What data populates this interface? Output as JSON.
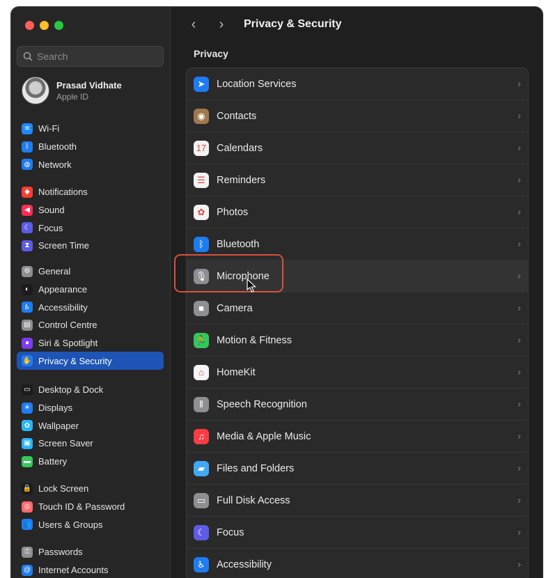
{
  "window": {
    "title": "Privacy & Security"
  },
  "search": {
    "placeholder": "Search"
  },
  "profile": {
    "name": "Prasad Vidhate",
    "subtitle": "Apple ID"
  },
  "sidebar": {
    "groups": [
      [
        {
          "label": "Wi-Fi",
          "icon": "wifi-icon",
          "color": "#1e88ff",
          "glyph": "≋"
        },
        {
          "label": "Bluetooth",
          "icon": "bluetooth-icon",
          "color": "#1e7cf2",
          "glyph": "ᛒ"
        },
        {
          "label": "Network",
          "icon": "globe-icon",
          "color": "#1e7cf2",
          "glyph": "◍"
        }
      ],
      [
        {
          "label": "Notifications",
          "icon": "bell-icon",
          "color": "#ff3b30",
          "glyph": "◆"
        },
        {
          "label": "Sound",
          "icon": "speaker-icon",
          "color": "#ff2d55",
          "glyph": "◀"
        },
        {
          "label": "Focus",
          "icon": "moon-icon",
          "color": "#5e5ce6",
          "glyph": "☾"
        },
        {
          "label": "Screen Time",
          "icon": "hourglass-icon",
          "color": "#5e5ce6",
          "glyph": "⧗"
        }
      ],
      [
        {
          "label": "General",
          "icon": "gear-icon",
          "color": "#8e8e93",
          "glyph": "⚙"
        },
        {
          "label": "Appearance",
          "icon": "appearance-icon",
          "color": "#1c1c1e",
          "glyph": "◐"
        },
        {
          "label": "Accessibility",
          "icon": "accessibility-icon",
          "color": "#1e7cf2",
          "glyph": "♿"
        },
        {
          "label": "Control Centre",
          "icon": "control-centre-icon",
          "color": "#8e8e93",
          "glyph": "▤"
        },
        {
          "label": "Siri & Spotlight",
          "icon": "siri-icon",
          "color": "#7d3cf0",
          "glyph": "●"
        },
        {
          "label": "Privacy & Security",
          "icon": "hand-icon",
          "color": "#1e7cf2",
          "glyph": "✋"
        }
      ],
      [
        {
          "label": "Desktop & Dock",
          "icon": "dock-icon",
          "color": "#1c1c1e",
          "glyph": "▭"
        },
        {
          "label": "Displays",
          "icon": "sun-icon",
          "color": "#1e7cf2",
          "glyph": "☀"
        },
        {
          "label": "Wallpaper",
          "icon": "flower-icon",
          "color": "#29b6f6",
          "glyph": "✿"
        },
        {
          "label": "Screen Saver",
          "icon": "screensaver-icon",
          "color": "#29b6f6",
          "glyph": "▣"
        },
        {
          "label": "Battery",
          "icon": "battery-icon",
          "color": "#34c759",
          "glyph": "▬"
        }
      ],
      [
        {
          "label": "Lock Screen",
          "icon": "lock-icon",
          "color": "#1c1c1e",
          "glyph": "🔒"
        },
        {
          "label": "Touch ID & Password",
          "icon": "fingerprint-icon",
          "color": "#ff6b6b",
          "glyph": "◎"
        },
        {
          "label": "Users & Groups",
          "icon": "users-icon",
          "color": "#1e7cf2",
          "glyph": "👥"
        }
      ],
      [
        {
          "label": "Passwords",
          "icon": "key-icon",
          "color": "#8e8e93",
          "glyph": "⚿"
        },
        {
          "label": "Internet Accounts",
          "icon": "at-icon",
          "color": "#1e7cf2",
          "glyph": "@"
        }
      ]
    ]
  },
  "main": {
    "section_title": "Privacy",
    "rows": [
      {
        "label": "Location Services",
        "icon": "location-arrow-icon",
        "color": "#1e7cf2",
        "glyph": "➤"
      },
      {
        "label": "Contacts",
        "icon": "contacts-icon",
        "color": "#a0784e",
        "glyph": "◉"
      },
      {
        "label": "Calendars",
        "icon": "calendar-icon",
        "color": "#f2f2f2",
        "glyph": "17"
      },
      {
        "label": "Reminders",
        "icon": "reminders-icon",
        "color": "#f2f2f2",
        "glyph": "☰"
      },
      {
        "label": "Photos",
        "icon": "photos-icon",
        "color": "#f2f2f2",
        "glyph": "✿"
      },
      {
        "label": "Bluetooth",
        "icon": "bluetooth-icon",
        "color": "#1e7cf2",
        "glyph": "ᛒ"
      },
      {
        "label": "Microphone",
        "icon": "microphone-icon",
        "color": "#8e8e93",
        "glyph": "🎙"
      },
      {
        "label": "Camera",
        "icon": "camera-icon",
        "color": "#8e8e93",
        "glyph": "■"
      },
      {
        "label": "Motion & Fitness",
        "icon": "fitness-icon",
        "color": "#34c759",
        "glyph": "🏃"
      },
      {
        "label": "HomeKit",
        "icon": "home-icon",
        "color": "#f5f5f5",
        "glyph": "⌂"
      },
      {
        "label": "Speech Recognition",
        "icon": "waveform-icon",
        "color": "#8e8e93",
        "glyph": "⦀"
      },
      {
        "label": "Media & Apple Music",
        "icon": "music-icon",
        "color": "#fc3c44",
        "glyph": "♫"
      },
      {
        "label": "Files and Folders",
        "icon": "folder-icon",
        "color": "#3fa9f5",
        "glyph": "▰"
      },
      {
        "label": "Full Disk Access",
        "icon": "disk-icon",
        "color": "#8e8e93",
        "glyph": "▭"
      },
      {
        "label": "Focus",
        "icon": "moon-icon",
        "color": "#5e5ce6",
        "glyph": "☾"
      },
      {
        "label": "Accessibility",
        "icon": "accessibility-icon",
        "color": "#1e7cf2",
        "glyph": "♿"
      }
    ]
  }
}
